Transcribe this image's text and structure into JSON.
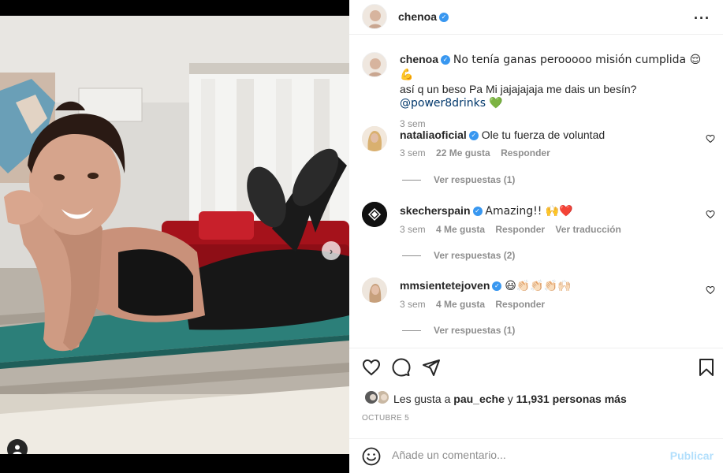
{
  "post": {
    "author": "chenoa",
    "caption_user": "chenoa",
    "caption_line1": "No tenía ganas perooooo misión cumplida 😌💪",
    "caption_line2": "así q un beso Pa Mi jajajajaja me dais un besín?",
    "caption_mention": "@power8drinks 💚",
    "caption_time": "3 sem"
  },
  "comments": [
    {
      "user": "nataliaoficial",
      "text": "Ole tu fuerza de voluntad",
      "time": "3 sem",
      "likes": "22 Me gusta",
      "reply": "Responder",
      "translate": "",
      "replies": "Ver respuestas (1)"
    },
    {
      "user": "skecherspain",
      "text": "Amazing!! 🙌❤️",
      "time": "3 sem",
      "likes": "4 Me gusta",
      "reply": "Responder",
      "translate": "Ver traducción",
      "replies": "Ver respuestas (2)"
    },
    {
      "user": "mmsientetejoven",
      "text": "😃👏🏻👏🏻👏🏻🙌🏻",
      "time": "3 sem",
      "likes": "4 Me gusta",
      "reply": "Responder",
      "translate": "",
      "replies": "Ver respuestas (1)"
    }
  ],
  "likes": {
    "prefix": "Les gusta a",
    "user": "pau_eche",
    "conj": "y",
    "count": "11,931 personas más"
  },
  "date": "OCTUBRE 5",
  "comment_box": {
    "placeholder": "Añade un comentario...",
    "publish": "Publicar"
  },
  "colors": {
    "verified": "#3897f0",
    "publish_disabled": "#b2dffc",
    "secondary_text": "#8e8e8e"
  },
  "icons": [
    "more-icon",
    "heart-icon",
    "comment-icon",
    "share-icon",
    "bookmark-icon",
    "emoji-icon",
    "next-arrow-icon",
    "tag-user-icon",
    "verified-icon"
  ]
}
